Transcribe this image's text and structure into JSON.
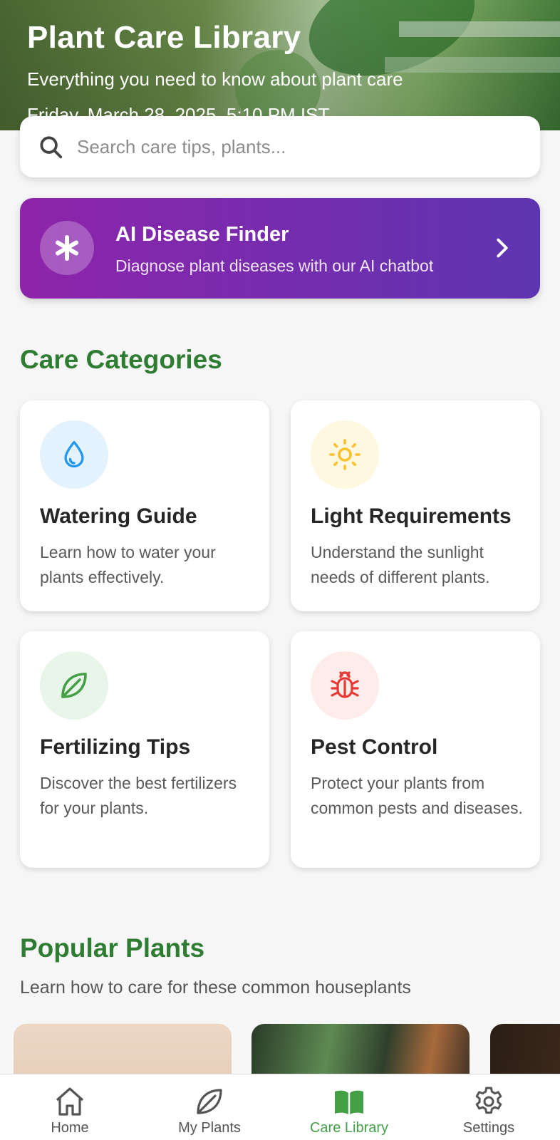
{
  "header": {
    "title": "Plant Care Library",
    "subtitle": "Everything you need to know about plant care",
    "datetime": "Friday, March 28, 2025, 5:10 PM IST"
  },
  "search": {
    "placeholder": "Search care tips, plants...",
    "icon": "search-icon"
  },
  "ai_finder": {
    "title": "AI Disease Finder",
    "subtitle": "Diagnose plant diseases with our AI chatbot",
    "icon": "asterisk-icon",
    "gradient": [
      "#8e24aa",
      "#5e35b1"
    ]
  },
  "care_categories": {
    "title": "Care Categories",
    "items": [
      {
        "title": "Watering Guide",
        "description": "Learn how to water your plants effectively.",
        "icon": "water-drop-icon",
        "color": "#2196f3",
        "bg": "#e3f2fd"
      },
      {
        "title": "Light Requirements",
        "description": "Understand the sunlight needs of different plants.",
        "icon": "sun-icon",
        "color": "#fbc02d",
        "bg": "#fff8e1"
      },
      {
        "title": "Fertilizing Tips",
        "description": "Discover the best fertilizers for your plants.",
        "icon": "leaf-icon",
        "color": "#43a047",
        "bg": "#e8f5e9"
      },
      {
        "title": "Pest Control",
        "description": "Protect your plants from common pests and diseases.",
        "icon": "bug-icon",
        "color": "#e53935",
        "bg": "#fdecea"
      }
    ]
  },
  "popular_plants": {
    "title": "Popular Plants",
    "subtitle": "Learn how to care for these common houseplants"
  },
  "bottom_nav": {
    "active": "Care Library",
    "accent": "#43a047",
    "items": [
      {
        "label": "Home",
        "icon": "home-icon"
      },
      {
        "label": "My Plants",
        "icon": "leaf-icon"
      },
      {
        "label": "Care Library",
        "icon": "book-icon"
      },
      {
        "label": "Settings",
        "icon": "gear-icon"
      }
    ]
  }
}
